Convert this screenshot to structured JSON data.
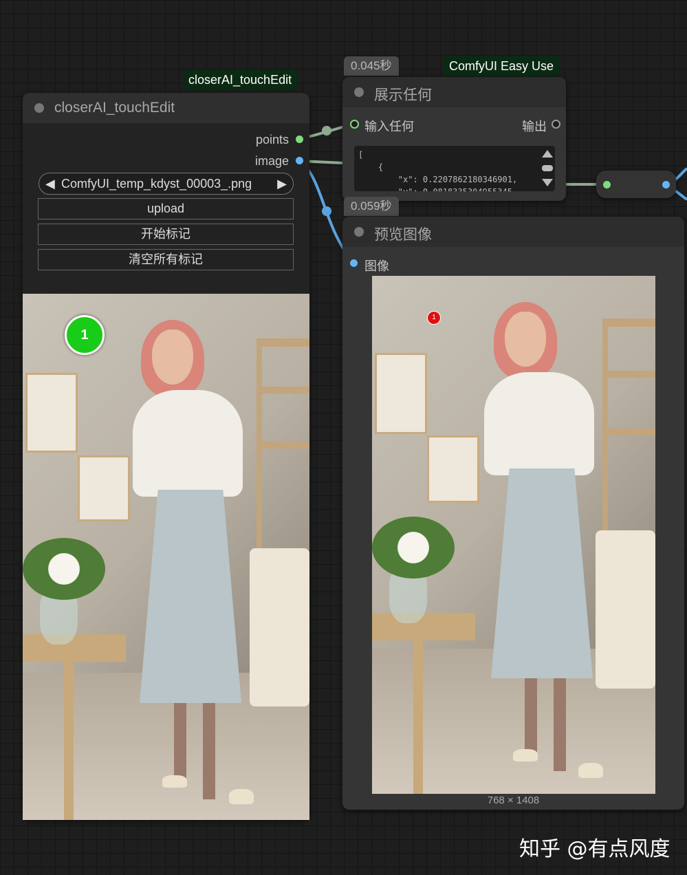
{
  "node_touchedit": {
    "badge": "closerAI_touchEdit",
    "title": "closerAI_touchEdit",
    "outputs": [
      {
        "label": "points",
        "color": "#7edc7e"
      },
      {
        "label": "image",
        "color": "#64b5f6"
      }
    ],
    "file_combo": {
      "value": "ComfyUI_temp_kdyst_00003_.png",
      "left_arrow": "◀",
      "right_arrow": "▶"
    },
    "buttons": [
      "upload",
      "开始标记",
      "清空所有标记"
    ],
    "marker": {
      "label": "1",
      "color": "#19cc19"
    }
  },
  "node_show_any": {
    "time": "0.045秒",
    "badge": "ComfyUI Easy Use",
    "title": "展示任何",
    "input_label": "输入任何",
    "output_label": "输出",
    "text_content": "[\n    {\n        \"x\": 0.2207862180346901,\n        \"y\": 0.0818335304955345..."
  },
  "node_reroute": {
    "input_color": "#7edc7e",
    "output_color": "#64b5f6"
  },
  "node_preview": {
    "time": "0.059秒",
    "title": "预览图像",
    "input_label": "图像",
    "image_size": "768 × 1408",
    "marker": {
      "label": "1",
      "color": "#e01010"
    }
  },
  "watermark": "知乎 @有点风度"
}
